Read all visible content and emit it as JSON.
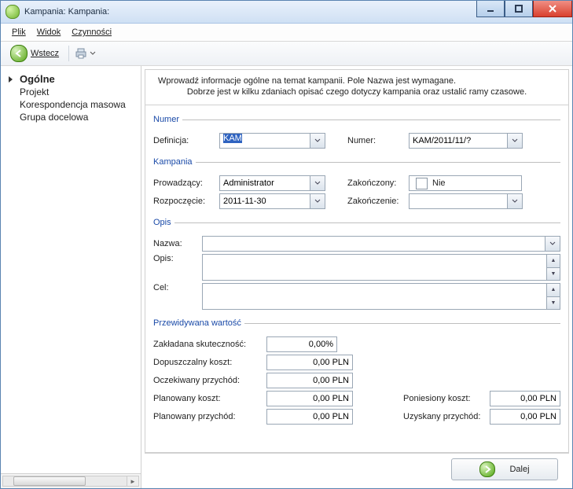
{
  "window": {
    "title": "Kampania: Kampania:"
  },
  "menu": {
    "file": "Plik",
    "view": "Widok",
    "actions": "Czynności"
  },
  "toolbar": {
    "back": "Wstecz"
  },
  "sidebar": {
    "items": [
      {
        "label": "Ogólne",
        "active": true
      },
      {
        "label": "Projekt"
      },
      {
        "label": "Korespondencja masowa"
      },
      {
        "label": "Grupa docelowa"
      }
    ]
  },
  "hint": {
    "line1": "Wprowadź informacje ogólne na temat kampanii. Pole Nazwa jest wymagane.",
    "line2": "Dobrze jest w kilku zdaniach opisać czego dotyczy kampania oraz ustalić ramy czasowe."
  },
  "group_numer": {
    "legend": "Numer",
    "definition_label": "Definicja:",
    "definition_value": "KAM",
    "number_label": "Numer:",
    "number_value": "KAM/2011/11/?"
  },
  "group_kampania": {
    "legend": "Kampania",
    "owner_label": "Prowadzący:",
    "owner_value": "Administrator",
    "finished_label": "Zakończony:",
    "finished_text": "Nie",
    "start_label": "Rozpoczęcie:",
    "start_value": "2011-11-30",
    "end_label": "Zakończenie:",
    "end_value": ""
  },
  "group_opis": {
    "legend": "Opis",
    "name_label": "Nazwa:",
    "name_value": "",
    "desc_label": "Opis:",
    "desc_value": "",
    "goal_label": "Cel:",
    "goal_value": ""
  },
  "group_value": {
    "legend": "Przewidywana wartość",
    "eff_label": "Zakładana skuteczność:",
    "eff_value": "0,00%",
    "allow_cost_label": "Dopuszczalny  koszt:",
    "allow_cost_value": "0,00 PLN",
    "exp_rev_label": "Oczekiwany przychód:",
    "exp_rev_value": "0,00 PLN",
    "plan_cost_label": "Planowany koszt:",
    "plan_cost_value": "0,00 PLN",
    "real_cost_label": "Poniesiony koszt:",
    "real_cost_value": "0,00 PLN",
    "plan_rev_label": "Planowany przychód:",
    "plan_rev_value": "0,00 PLN",
    "real_rev_label": "Uzyskany przychód:",
    "real_rev_value": "0,00 PLN"
  },
  "footer": {
    "next": "Dalej"
  }
}
